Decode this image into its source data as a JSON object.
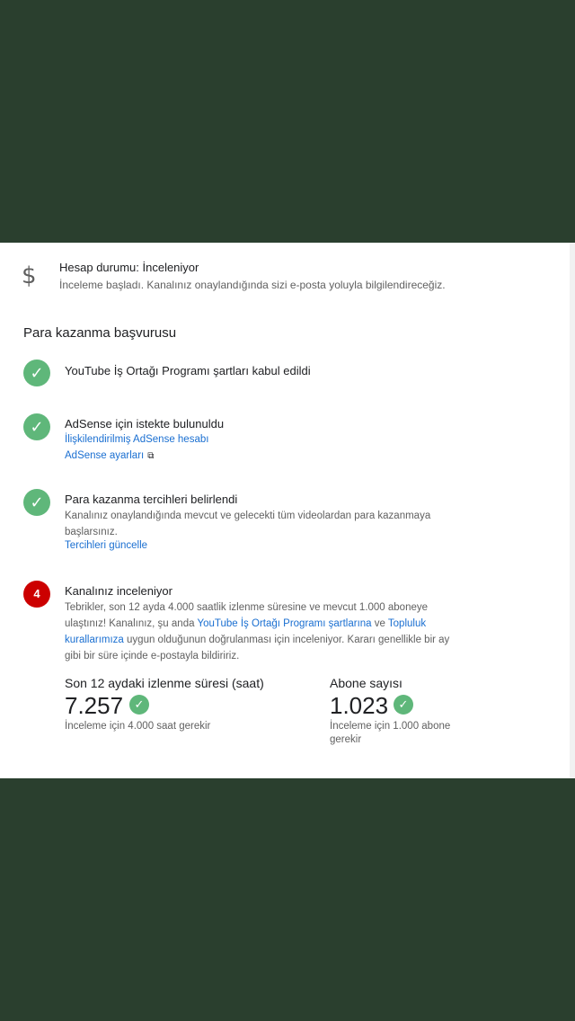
{
  "account_status": {
    "icon": "dollar-icon",
    "title": "Hesap durumu: İnceleniyor",
    "description": "İnceleme başladı. Kanalınız onaylandığında sizi e-posta yoluyla bilgilendireceğiz."
  },
  "application": {
    "title": "Para kazanma başvurusu",
    "steps": [
      {
        "status": "done",
        "title": "YouTube İş Ortağı Programı şartları kabul edildi"
      },
      {
        "status": "done",
        "title": "AdSense için istekte bulunuldu",
        "link1": "İlişkilendirilmiş AdSense hesabı",
        "link2": "AdSense ayarları"
      },
      {
        "status": "done",
        "title": "Para kazanma tercihleri belirlendi",
        "desc": "Kanalınız onaylandığında mevcut ve gelecekti tüm videolardan para kazanmaya başlarsınız.",
        "link": "Tercihleri güncelle"
      },
      {
        "status": "current",
        "number": "4",
        "title": "Kanalınız inceleniyor",
        "desc_part1": "Tebrikler, son 12 ayda 4.000 saatlik izlenme süresine ve mevcut 1.000 aboneye ulaştınız! Kanalınız, şu anda ",
        "desc_link1": "YouTube İş Ortağı Programı şartlarına",
        "desc_part2": " ve ",
        "desc_link2": "Topluluk kurallarımıza",
        "desc_part3": " uygun olduğunun doğrulanması için inceleniyor. Kararı genellikle bir ay gibi bir süre içinde e-postayla bildiririz."
      }
    ],
    "metrics": [
      {
        "label": "Son 12 aydaki izlenme süresi (saat)",
        "value": "7.257",
        "note": "İnceleme için 4.000 saat gerekir"
      },
      {
        "label": "Abone sayısı",
        "value": "1.023",
        "note": "İnceleme için 1.000 abone gerekir"
      }
    ]
  },
  "colors": {
    "background": "#2a3f2e",
    "check": "#5fb77a",
    "step_badge": "#cc0000",
    "link": "#1a6fd1"
  }
}
